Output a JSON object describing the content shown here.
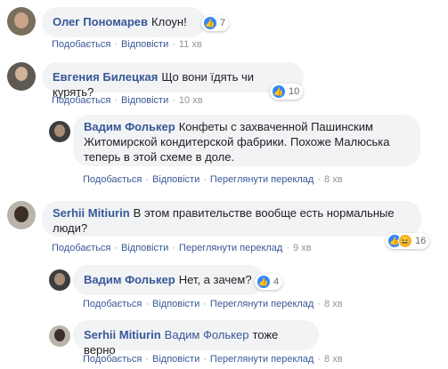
{
  "comments": [
    {
      "name": "Олег Пономарев",
      "text": "Клоун!",
      "like": "Подобається",
      "reply": "Відповісти",
      "translate": "",
      "time": "11 хв",
      "reactions": "7"
    },
    {
      "name": "Евгения Билецкая",
      "text": "Що вони їдять чи курять?",
      "like": "Подобається",
      "reply": "Відповісти",
      "translate": "",
      "time": "10 хв",
      "reactions": "10"
    },
    {
      "name": "Вадим Фолькер",
      "text_line1": "Конфеты с захваченной Пашинским",
      "text_line2": "Житомирской кондитерской фабрики. Похоже Малюська",
      "text_line3": "теперь в этой схеме в доле.",
      "like": "Подобається",
      "reply": "Відповісти",
      "translate": "Переглянути переклад",
      "time": "8 хв"
    },
    {
      "name": "Serhii Mitiurin",
      "text_line1": "В этом правительстве вообще есть нормальные",
      "text_line2": "люди?",
      "like": "Подобається",
      "reply": "Відповісти",
      "translate": "Переглянути переклад",
      "time": "9 хв",
      "reactions": "16"
    },
    {
      "name": "Вадим Фолькер",
      "text": "Нет, а зачем?",
      "like": "Подобається",
      "reply": "Відповісти",
      "translate": "Переглянути переклад",
      "time": "8 хв",
      "reactions": "4"
    },
    {
      "name": "Serhii Mitiurin",
      "mention": "Вадим Фолькер",
      "text": "тоже верно",
      "like": "Подобається",
      "reply": "Відповісти",
      "translate": "Переглянути переклад",
      "time": "8 хв"
    }
  ],
  "colors": {
    "link": "#385898",
    "bubble": "#f2f3f5",
    "like": "#2d88ff",
    "meta": "#90949c"
  }
}
